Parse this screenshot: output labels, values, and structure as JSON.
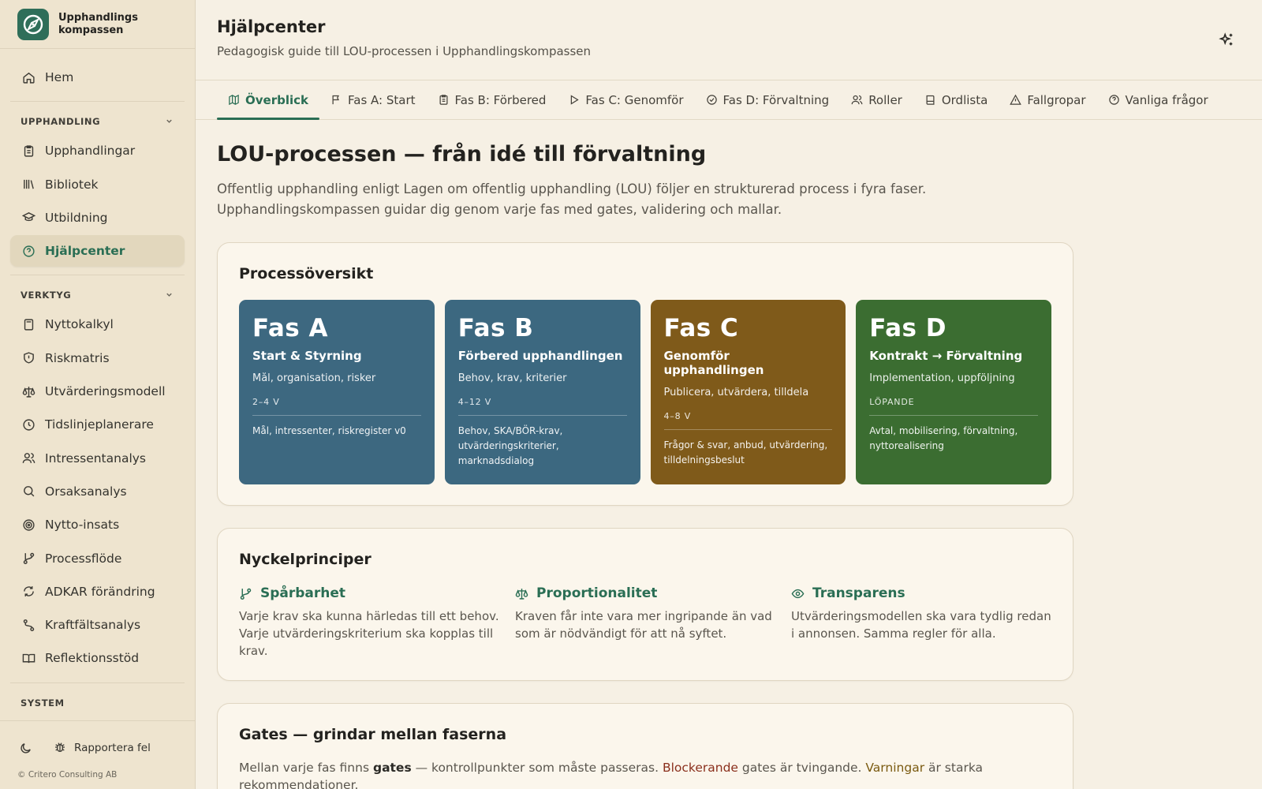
{
  "brand": {
    "name_line1": "Upphandlings",
    "name_line2": "kompassen"
  },
  "nav": {
    "home": "Hem",
    "sections": [
      {
        "title": "UPPHANDLING",
        "items": [
          "Upphandlingar",
          "Bibliotek",
          "Utbildning",
          "Hjälpcenter"
        ]
      },
      {
        "title": "VERKTYG",
        "items": [
          "Nyttokalkyl",
          "Riskmatris",
          "Utvärderingsmodell",
          "Tidslinjeplanerare",
          "Intressentanalys",
          "Orsaksanalys",
          "Nytto-insats",
          "Processflöde",
          "ADKAR förändring",
          "Kraftfältsanalys",
          "Reflektionsstöd"
        ]
      },
      {
        "title": "SYSTEM"
      }
    ],
    "active": "Hjälpcenter"
  },
  "footer": {
    "report_label": "Rapportera fel",
    "copyright": "© Critero Consulting AB"
  },
  "header": {
    "title": "Hjälpcenter",
    "subtitle": "Pedagogisk guide till LOU-processen i Upphandlingskompassen"
  },
  "tabs": [
    "Överblick",
    "Fas A: Start",
    "Fas B: Förbered",
    "Fas C: Genomför",
    "Fas D: Förvaltning",
    "Roller",
    "Ordlista",
    "Fallgropar",
    "Vanliga frågor"
  ],
  "hero": {
    "title": "LOU-processen — från idé till förvaltning",
    "desc_line1": "Offentlig upphandling enligt Lagen om offentlig upphandling (LOU) följer en strukturerad process i fyra faser.",
    "desc_line2": "Upphandlingskompassen guidar dig genom varje fas med gates, validering och mallar."
  },
  "overview": {
    "title": "Processöversikt",
    "phases": [
      {
        "code": "Fas A",
        "name": "Start & Styrning",
        "desc": "Mål, organisation, risker",
        "duration": "2–4 V",
        "outputs": "Mål, intressenter, riskregister v0",
        "color": "#3d6880"
      },
      {
        "code": "Fas B",
        "name": "Förbered upphandlingen",
        "desc": "Behov, krav, kriterier",
        "duration": "4–12 V",
        "outputs": "Behov, SKA/BÖR-krav, utvärderingskriterier, marknadsdialog",
        "color": "#3c6880"
      },
      {
        "code": "Fas C",
        "name": "Genomför upphandlingen",
        "desc": "Publicera, utvärdera, tilldela",
        "duration": "4–8 V",
        "outputs": "Frågor & svar, anbud, utvärdering, tilldelningsbeslut",
        "color": "#7f5a1a"
      },
      {
        "code": "Fas D",
        "name": "Kontrakt → Förvaltning",
        "desc": "Implementation, uppföljning",
        "duration": "LÖPANDE",
        "outputs": "Avtal, mobilisering, förvaltning, nyttorealisering",
        "color": "#3b6d31"
      }
    ]
  },
  "principles": {
    "title": "Nyckelprinciper",
    "items": [
      {
        "title": "Spårbarhet",
        "text": "Varje krav ska kunna härledas till ett behov. Varje utvärderingskriterium ska kopplas till krav."
      },
      {
        "title": "Proportionalitet",
        "text": "Kraven får inte vara mer ingripande än vad som är nödvändigt för att nå syftet."
      },
      {
        "title": "Transparens",
        "text": "Utvärderingsmodellen ska vara tydlig redan i annonsen. Samma regler för alla."
      }
    ]
  },
  "gates": {
    "title": "Gates — grindar mellan faserna",
    "t1": "Mellan varje fas finns ",
    "b1": "gates",
    "t2": " — kontrollpunkter som måste passeras. ",
    "red": "Blockerande",
    "t3": " gates är tvingande. ",
    "amber": "Varningar",
    "t4": " är starka rekommendationer."
  },
  "colors": {
    "accent": "#2a6e54",
    "sidebar_bg": "#eee4cf",
    "page_bg": "#f6f0e4"
  }
}
